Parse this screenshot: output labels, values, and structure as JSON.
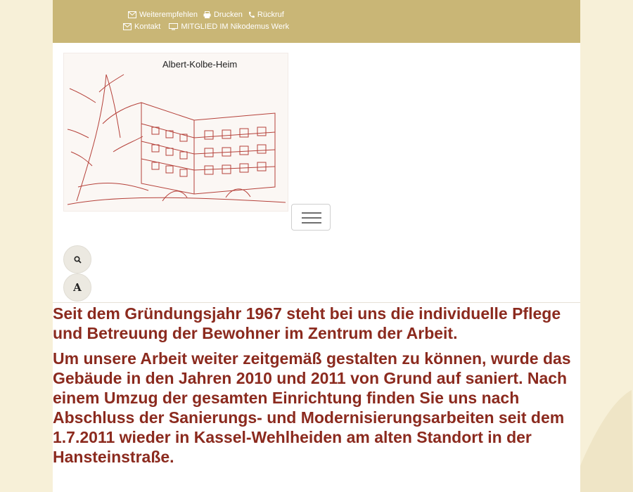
{
  "topbar": {
    "links_row1": [
      {
        "label": "Weiterempfehlen",
        "icon": "envelope-icon"
      },
      {
        "label": "Drucken",
        "icon": "print-icon"
      },
      {
        "label": "Rückruf",
        "icon": "phone-icon"
      }
    ],
    "links_row2": [
      {
        "label": "Kontakt",
        "icon": "envelope-icon"
      },
      {
        "label": "MITGLIED IM Nikodemus Werk",
        "icon": "monitor-icon"
      }
    ]
  },
  "logo": {
    "title": "Albert-Kolbe-Heim"
  },
  "tools": {
    "search_icon": "search-icon",
    "font_size_label": "A"
  },
  "content": {
    "paragraph1": "Seit dem Gründungsjahr 1967 steht bei uns die individuelle Pflege und Betreuung der Bewohner im Zentrum der Arbeit.",
    "paragraph2": "Um unsere Arbeit weiter zeitgemäß gestalten zu können, wurde das Gebäude in den Jahren 2010 und 2011 von Grund auf saniert. Nach einem Umzug der gesamten Einrichtung finden Sie uns nach Abschluss der Sanierungs- und Modernisierungsarbeiten seit dem 1.7.2011 wieder in Kassel-Wehlheiden am alten Standort in der Hansteinstraße."
  },
  "colors": {
    "topbar": "#c9b676",
    "text": "#8b2a1e",
    "background": "#f7f0d8"
  }
}
